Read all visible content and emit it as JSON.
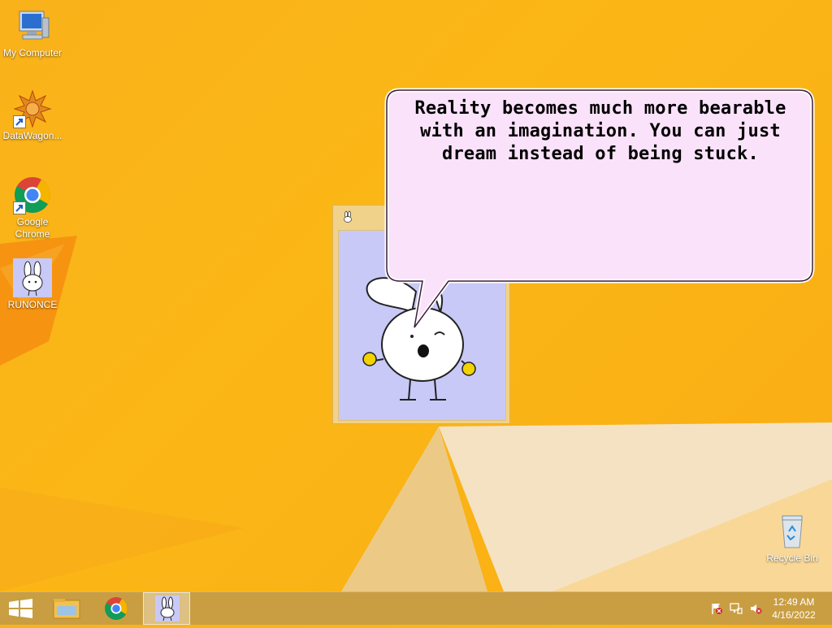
{
  "desktop": {
    "icons": [
      {
        "label": "My Computer",
        "icon": "computer-icon"
      },
      {
        "label": "DataWagon...",
        "icon": "datawagon-icon"
      },
      {
        "label": "Google Chrome",
        "icon": "chrome-icon"
      },
      {
        "label": "RUNONCE",
        "icon": "bunny-icon"
      },
      {
        "label": "Recycle Bin",
        "icon": "recycle-bin-icon"
      }
    ]
  },
  "bubble": {
    "text": "Reality becomes much more bearable with an imagination. You can just dream instead of being stuck."
  },
  "taskbar": {
    "buttons": [
      {
        "icon": "windows-start-icon"
      },
      {
        "icon": "file-explorer-icon"
      },
      {
        "icon": "chrome-icon"
      },
      {
        "icon": "bunny-icon",
        "active": true
      }
    ],
    "tray": [
      "flag-icon",
      "network-icon",
      "volume-muted-icon"
    ],
    "time": "12:49 AM",
    "date": "4/16/2022"
  },
  "colors": {
    "wallpaper": "#f9b21a",
    "bubble_fill": "#fbe2fb",
    "app_client": "#c9c9f7"
  }
}
